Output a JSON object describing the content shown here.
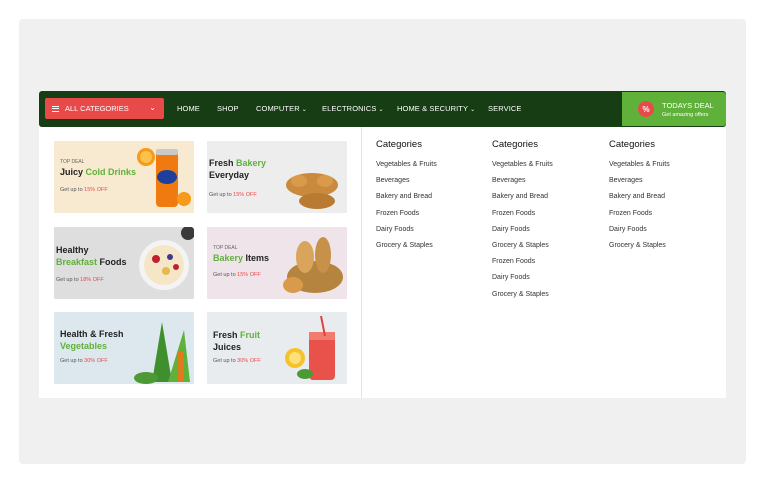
{
  "nav": {
    "all_categories": "ALL CATEGORIES",
    "items": [
      "HOME",
      "SHOP",
      "COMPUTER",
      "ELECTRONICS",
      "HOME & SECURITY",
      "SERVICE"
    ],
    "deal_title": "TODAYS DEAL",
    "deal_sub": "Get amazing offers",
    "deal_badge": "%"
  },
  "banners": [
    {
      "tag": "TOP DEAL",
      "title_a": "Juicy ",
      "title_b": "Cold Drinks",
      "offer_a": "Get up to ",
      "offer_b": "15% OFF"
    },
    {
      "title_a": "Fresh ",
      "title_b": "Bakery",
      "title_c": "Everyday",
      "offer_a": "Get up to ",
      "offer_b": "15% OFF"
    },
    {
      "title_a": "Healthy",
      "title_b": "Breakfast",
      "title_c": " Foods",
      "offer_a": "Get up to ",
      "offer_b": "18% OFF"
    },
    {
      "tag": "TOP DEAL",
      "title_a": "Bakery",
      "title_b": " Items",
      "offer_a": "Get up to ",
      "offer_b": "15% OFF"
    },
    {
      "title_a": "Health & Fresh",
      "title_b": "Vegetables",
      "offer_a": "Get up to ",
      "offer_b": "30% OFF"
    },
    {
      "title_a": "Fresh ",
      "title_b": "Fruit",
      "title_c": "Juices",
      "offer_a": "Get up to ",
      "offer_b": "30% OFF"
    }
  ],
  "columns": [
    {
      "heading": "Categories",
      "links": [
        "Vegetables & Fruits",
        "Beverages",
        "Bakery and Bread",
        "Frozen Foods",
        "Dairy Foods",
        "Grocery & Staples"
      ]
    },
    {
      "heading": "Categories",
      "links": [
        "Vegetables & Fruits",
        "Beverages",
        "Bakery and Bread",
        "Frozen Foods",
        "Dairy Foods",
        "Grocery & Staples",
        "Frozen Foods",
        "Dairy Foods",
        "Grocery & Staples"
      ]
    },
    {
      "heading": "Categories",
      "links": [
        "Vegetables & Fruits",
        "Beverages",
        "Bakery and Bread",
        "Frozen Foods",
        "Dairy Foods",
        "Grocery & Staples"
      ]
    }
  ],
  "colors": {
    "nav_bg": "#163d13",
    "accent_red": "#e84a4a",
    "accent_green": "#5fb13a"
  }
}
